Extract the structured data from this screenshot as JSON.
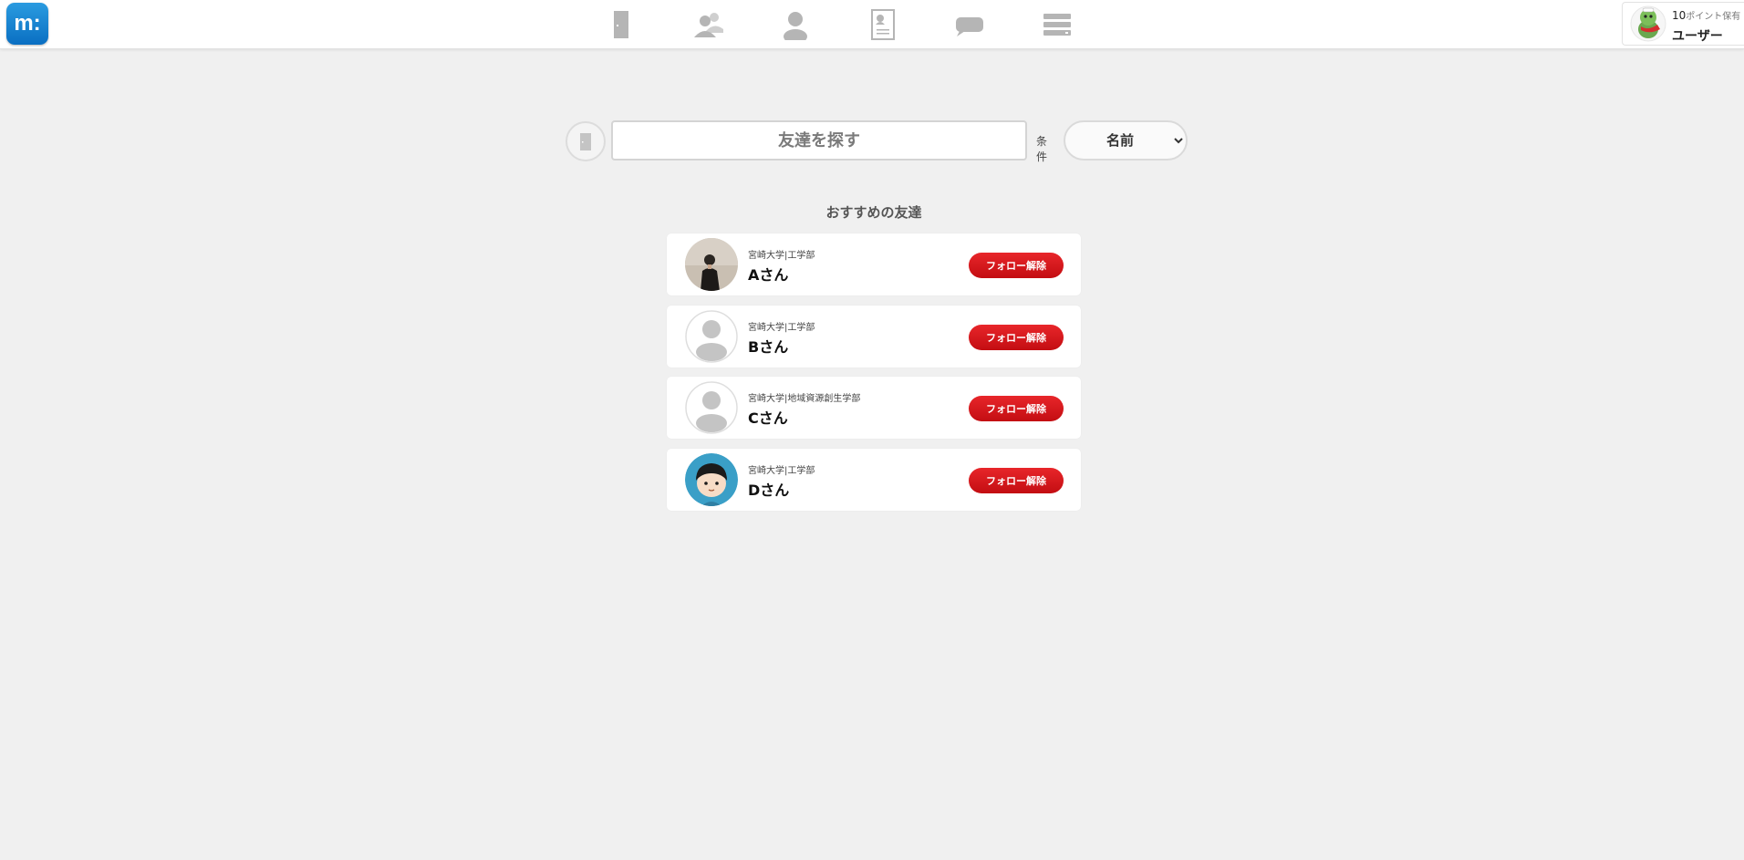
{
  "header": {
    "logo_text": "m:",
    "nav_icons": [
      "door-icon",
      "friends-icon",
      "person-icon",
      "profile-card-icon",
      "chat-bubble-icon",
      "menu-list-icon"
    ],
    "user": {
      "points_value": "10",
      "points_label": "ポイント保有",
      "name": "ユーザー"
    }
  },
  "search": {
    "placeholder": "友達を探す",
    "condition_label": "条件",
    "condition_options": [
      "名前"
    ],
    "condition_selected": "名前"
  },
  "recommend": {
    "title": "おすすめの友達",
    "friends": [
      {
        "university": "宮崎大学|工学部",
        "name": "Aさん",
        "button": "フォロー解除",
        "avatar": "photo"
      },
      {
        "university": "宮崎大学|工学部",
        "name": "Bさん",
        "button": "フォロー解除",
        "avatar": "default"
      },
      {
        "university": "宮崎大学|地域資源創生学部",
        "name": "Cさん",
        "button": "フォロー解除",
        "avatar": "default"
      },
      {
        "university": "宮崎大学|工学部",
        "name": "Dさん",
        "button": "フォロー解除",
        "avatar": "cartoon"
      }
    ]
  },
  "colors": {
    "background": "#f0f0f0",
    "accent_red": "#d4161b",
    "logo_blue": "#1584d2",
    "icon_gray": "#b5b5b5"
  }
}
